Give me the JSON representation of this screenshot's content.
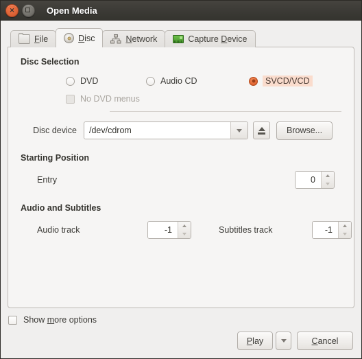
{
  "window": {
    "title": "Open Media",
    "close_icon": "close-icon",
    "maximize_icon": "maximize-icon"
  },
  "tabs": [
    {
      "id": "file",
      "label": "File",
      "accel": "F",
      "icon": "folder-icon",
      "active": false
    },
    {
      "id": "disc",
      "label": "Disc",
      "accel": "D",
      "icon": "disc-icon",
      "active": true
    },
    {
      "id": "network",
      "label": "Network",
      "accel": "N",
      "icon": "network-icon",
      "active": false
    },
    {
      "id": "capture",
      "label": "Capture Device",
      "accel": "D",
      "icon": "capture-card-icon",
      "active": false
    }
  ],
  "disc_selection": {
    "title": "Disc Selection",
    "options": [
      {
        "id": "dvd",
        "label": "DVD",
        "selected": false
      },
      {
        "id": "audio_cd",
        "label": "Audio CD",
        "selected": false
      },
      {
        "id": "svcd_vcd",
        "label": "SVCD/VCD",
        "selected": true
      }
    ],
    "no_dvd_menus": {
      "label": "No DVD menus",
      "checked": false,
      "enabled": false
    },
    "device": {
      "label": "Disc device",
      "value": "/dev/cdrom",
      "dropdown_icon": "chevron-down-icon",
      "eject_icon": "eject-icon",
      "browse_label": "Browse..."
    }
  },
  "starting_position": {
    "title": "Starting Position",
    "entry": {
      "label": "Entry",
      "value": "0"
    }
  },
  "audio_subtitles": {
    "title": "Audio and Subtitles",
    "audio_track": {
      "label": "Audio track",
      "value": "-1"
    },
    "subtitles_track": {
      "label": "Subtitles track",
      "value": "-1"
    }
  },
  "footer": {
    "show_more": {
      "label_pre": "Show ",
      "accel": "m",
      "label_post": "ore options",
      "checked": false
    },
    "play": {
      "label_pre": "",
      "accel": "P",
      "label_post": "lay"
    },
    "play_dropdown_icon": "chevron-down-icon",
    "cancel": {
      "label_pre": "",
      "accel": "C",
      "label_post": "ancel"
    }
  },
  "colors": {
    "accent": "#e8703c",
    "highlight": "#fadccd",
    "titlebar": "#3b3a35",
    "panel": "#f6f5f4",
    "dialog": "#f0efee"
  }
}
